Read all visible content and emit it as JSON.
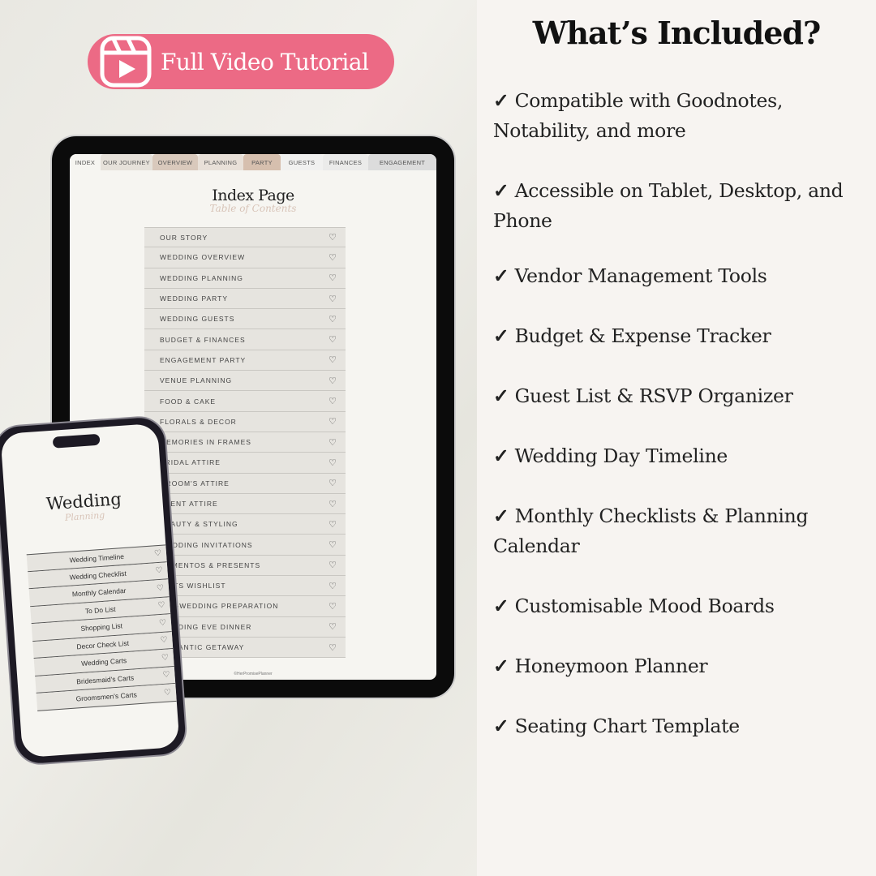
{
  "colors": {
    "accent": "#ec6a85",
    "right_bg": "#f7f4f1"
  },
  "tutorial_button": {
    "label": "Full Video Tutorial",
    "icon": "video-reel-icon"
  },
  "tablet": {
    "tabs": [
      {
        "label": "INDEX",
        "color": "#f6f5f1"
      },
      {
        "label": "OUR JOURNEY",
        "color": "#e6e1da"
      },
      {
        "label": "OVERVIEW",
        "color": "#d9c9bc"
      },
      {
        "label": "PLANNING",
        "color": "#e8e0d8"
      },
      {
        "label": "PARTY",
        "color": "#d6bfae"
      },
      {
        "label": "GUESTS",
        "color": "#f1f1f0"
      },
      {
        "label": "FINANCES",
        "color": "#ebebea"
      },
      {
        "label": "ENGAGEMENT",
        "color": "#dcdcdc"
      }
    ],
    "title": "Index Page",
    "subtitle": "Table of Contents",
    "items": [
      "OUR STORY",
      "WEDDING OVERVIEW",
      "WEDDING PLANNING",
      "WEDDING PARTY",
      "WEDDING GUESTS",
      "BUDGET & FINANCES",
      "ENGAGEMENT PARTY",
      "VENUE PLANNING",
      "FOOD & CAKE",
      "FLORALS & DECOR",
      "MEMORIES IN FRAMES",
      "BRIDAL ATTIRE",
      "GROOM'S ATTIRE",
      "EVENT ATTIRE",
      "BEAUTY & STYLING",
      "WEDDING INVITATIONS",
      "MEMENTOS & PRESENTS",
      "GIFTS WISHLIST",
      "PRE-WEDDING PREPARATION",
      "WEDDING EVE DINNER",
      "ROMANTIC GETAWAY"
    ],
    "footer": "©HerPromisePlanner"
  },
  "phone": {
    "title": "Wedding",
    "subtitle": "Planning",
    "items": [
      "Wedding Timeline",
      "Wedding Checklist",
      "Monthly Calendar",
      "To Do List",
      "Shopping List",
      "Decor Check List",
      "Wedding Carts",
      "Bridesmaid's Carts",
      "Groomsmen's Carts"
    ]
  },
  "included": {
    "title": "What’s Included?",
    "check": "✓",
    "items": [
      "Compatible with Goodnotes, Notability, and more",
      "Accessible on Tablet, Desktop, and Phone",
      "Vendor Management Tools",
      "Budget & Expense Tracker",
      "Guest List & RSVP Organizer",
      "Wedding Day Timeline",
      "Monthly Checklists & Planning Calendar",
      "Customisable Mood Boards",
      "Honeymoon Planner",
      "Seating Chart Template"
    ]
  }
}
